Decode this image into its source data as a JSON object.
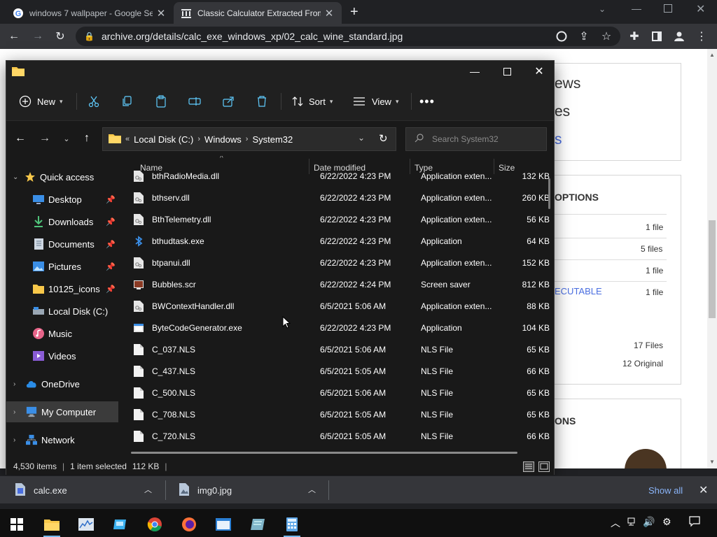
{
  "browser": {
    "tabs": [
      {
        "title": "windows 7 wallpaper - Google Se",
        "icon": "google-icon",
        "active": false
      },
      {
        "title": "Classic Calculator Extracted From",
        "icon": "archive-icon",
        "active": true
      }
    ],
    "new_tab": "+",
    "url": "archive.org/details/calc_exe_windows_xp/02_calc_wine_standard.jpg"
  },
  "webpage": {
    "heading_partial_1": "ews",
    "heading_partial_2": "es",
    "link_partial": "s",
    "section_title_1": "OPTIONS",
    "section_title_2": "ONS",
    "download_rows": [
      {
        "label": "",
        "count": "1 file"
      },
      {
        "label": "",
        "count": "5 files"
      },
      {
        "label": "",
        "count": "1 file"
      },
      {
        "label": "ECUTABLE",
        "count": "1 file"
      }
    ],
    "summary": [
      "17 Files",
      "12 Original"
    ]
  },
  "explorer": {
    "commands": {
      "new": "New",
      "sort": "Sort",
      "view": "View"
    },
    "address": {
      "prefix": "«",
      "crumbs": [
        "Local Disk (C:)",
        "Windows",
        "System32"
      ]
    },
    "search_placeholder": "Search System32",
    "nav": [
      {
        "label": "Quick access",
        "icon": "star-icon",
        "level": 0,
        "expander": "expanded"
      },
      {
        "label": "Desktop",
        "icon": "desktop-icon",
        "level": 1,
        "pinned": true
      },
      {
        "label": "Downloads",
        "icon": "download-arrow-icon",
        "level": 1,
        "pinned": true
      },
      {
        "label": "Documents",
        "icon": "documents-icon",
        "level": 1,
        "pinned": true
      },
      {
        "label": "Pictures",
        "icon": "pictures-icon",
        "level": 1,
        "pinned": true
      },
      {
        "label": "10125_icons",
        "icon": "folder-icon",
        "level": 1,
        "pinned": true
      },
      {
        "label": "Local Disk (C:)",
        "icon": "drive-icon",
        "level": 1
      },
      {
        "label": "Music",
        "icon": "music-icon",
        "level": 1
      },
      {
        "label": "Videos",
        "icon": "videos-icon",
        "level": 1
      },
      {
        "label": "OneDrive",
        "icon": "cloud-icon",
        "level": 0,
        "expander": "collapsed"
      },
      {
        "label": "My Computer",
        "icon": "computer-icon",
        "level": 0,
        "expander": "collapsed",
        "selected": true
      },
      {
        "label": "Network",
        "icon": "network-icon",
        "level": 0,
        "expander": "collapsed"
      }
    ],
    "columns": {
      "name": "Name",
      "date": "Date modified",
      "type": "Type",
      "size": "Size"
    },
    "files": [
      {
        "name": "bthRadioMedia.dll",
        "date": "6/22/2022 4:23 PM",
        "type": "Application exten...",
        "size": "132 KB",
        "icon": "dll-icon"
      },
      {
        "name": "bthserv.dll",
        "date": "6/22/2022 4:23 PM",
        "type": "Application exten...",
        "size": "260 KB",
        "icon": "dll-icon"
      },
      {
        "name": "BthTelemetry.dll",
        "date": "6/22/2022 4:23 PM",
        "type": "Application exten...",
        "size": "56 KB",
        "icon": "dll-icon"
      },
      {
        "name": "bthudtask.exe",
        "date": "6/22/2022 4:23 PM",
        "type": "Application",
        "size": "64 KB",
        "icon": "bluetooth-icon"
      },
      {
        "name": "btpanui.dll",
        "date": "6/22/2022 4:23 PM",
        "type": "Application exten...",
        "size": "152 KB",
        "icon": "dll-icon"
      },
      {
        "name": "Bubbles.scr",
        "date": "6/22/2022 4:24 PM",
        "type": "Screen saver",
        "size": "812 KB",
        "icon": "screensaver-icon"
      },
      {
        "name": "BWContextHandler.dll",
        "date": "6/5/2021 5:06 AM",
        "type": "Application exten...",
        "size": "88 KB",
        "icon": "dll-icon"
      },
      {
        "name": "ByteCodeGenerator.exe",
        "date": "6/22/2022 4:23 PM",
        "type": "Application",
        "size": "104 KB",
        "icon": "exe-icon"
      },
      {
        "name": "C_037.NLS",
        "date": "6/5/2021 5:06 AM",
        "type": "NLS File",
        "size": "65 KB",
        "icon": "file-icon"
      },
      {
        "name": "C_437.NLS",
        "date": "6/5/2021 5:05 AM",
        "type": "NLS File",
        "size": "66 KB",
        "icon": "file-icon"
      },
      {
        "name": "C_500.NLS",
        "date": "6/5/2021 5:06 AM",
        "type": "NLS File",
        "size": "65 KB",
        "icon": "file-icon"
      },
      {
        "name": "C_708.NLS",
        "date": "6/5/2021 5:05 AM",
        "type": "NLS File",
        "size": "65 KB",
        "icon": "file-icon"
      },
      {
        "name": "C_720.NLS",
        "date": "6/5/2021 5:05 AM",
        "type": "NLS File",
        "size": "66 KB",
        "icon": "file-icon"
      }
    ],
    "status": {
      "items": "4,530 items",
      "selected": "1 item selected",
      "size": "112 KB"
    }
  },
  "downloads": [
    {
      "name": "calc.exe",
      "icon": "exe-file-icon"
    },
    {
      "name": "img0.jpg",
      "icon": "image-file-icon"
    }
  ],
  "show_all": "Show all",
  "colors": {
    "accent_folder": "#f8c84a",
    "link_blue": "#4a6ee0",
    "explorer_bg": "#191919",
    "chrome_dark": "#202124"
  }
}
